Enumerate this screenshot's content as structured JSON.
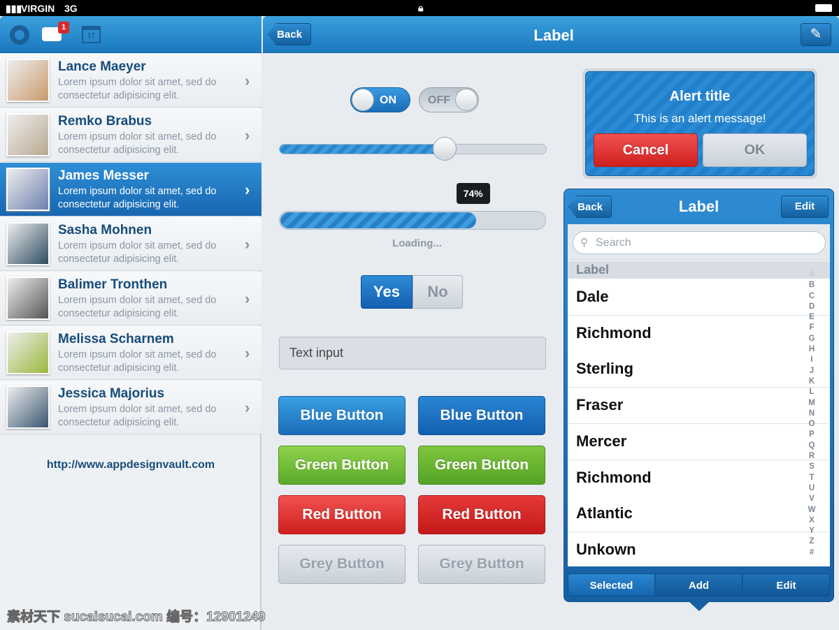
{
  "status": {
    "carrier": "VIRGIN",
    "network": "3G",
    "lock_icon": "lock-icon",
    "battery_icon": "battery-icon"
  },
  "sidebar": {
    "badge": "1",
    "calendar_day": "17",
    "contacts": [
      {
        "name": "Lance Maeyer",
        "desc": "Lorem ipsum dolor sit amet, sed do consectetur adipisicing elit.",
        "color": "#c99a6c"
      },
      {
        "name": "Remko Brabus",
        "desc": "Lorem ipsum dolor sit amet, sed do consectetur adipisicing elit.",
        "color": "#b9a890"
      },
      {
        "name": "James Messer",
        "desc": "Lorem ipsum dolor sit amet, sed do consectetur adipisicing elit.",
        "color": "#6c7fae",
        "selected": true
      },
      {
        "name": "Sasha Mohnen",
        "desc": "Lorem ipsum dolor sit amet, sed do consectetur adipisicing elit.",
        "color": "#2d4b60"
      },
      {
        "name": "Balimer Tronthen",
        "desc": "Lorem ipsum dolor sit amet, sed do consectetur adipisicing elit.",
        "color": "#555"
      },
      {
        "name": "Melissa Scharnem",
        "desc": "Lorem ipsum dolor sit amet, sed do consectetur adipisicing elit.",
        "color": "#9ab83c"
      },
      {
        "name": "Jessica Majorius",
        "desc": "Lorem ipsum dolor sit amet, sed do consectetur adipisicing elit.",
        "color": "#3a5570"
      }
    ],
    "url": "http://www.appdesignvault.com"
  },
  "header": {
    "back": "Back",
    "title": "Label"
  },
  "controls": {
    "toggle_on": "ON",
    "toggle_off": "OFF",
    "slider_value": 0.62,
    "progress": 0.74,
    "progress_label": "74%",
    "loading": "Loading...",
    "seg_yes": "Yes",
    "seg_no": "No",
    "text_input": "Text input"
  },
  "buttons": [
    "Blue Button",
    "Blue Button",
    "Green Button",
    "Green Button",
    "Red Button",
    "Red Button",
    "Grey Button",
    "Grey Button"
  ],
  "alert": {
    "title": "Alert title",
    "message": "This is an alert message!",
    "cancel": "Cancel",
    "ok": "OK"
  },
  "popover": {
    "back": "Back",
    "title": "Label",
    "edit": "Edit",
    "search_placeholder": "Search",
    "section": "Label",
    "items": [
      "Dale",
      "Richmond",
      "Sterling",
      "Fraser",
      "Mercer",
      "Richmond",
      "Atlantic",
      "Unkown"
    ],
    "index": [
      "A",
      "B",
      "C",
      "D",
      "E",
      "F",
      "G",
      "H",
      "I",
      "J",
      "K",
      "L",
      "M",
      "N",
      "O",
      "P",
      "Q",
      "R",
      "S",
      "T",
      "U",
      "V",
      "W",
      "X",
      "Y",
      "Z",
      "#"
    ],
    "tabs": [
      "Selected",
      "Add",
      "Edit"
    ]
  },
  "watermark": "素材天下 sucaisucai.com  编号：12901249"
}
